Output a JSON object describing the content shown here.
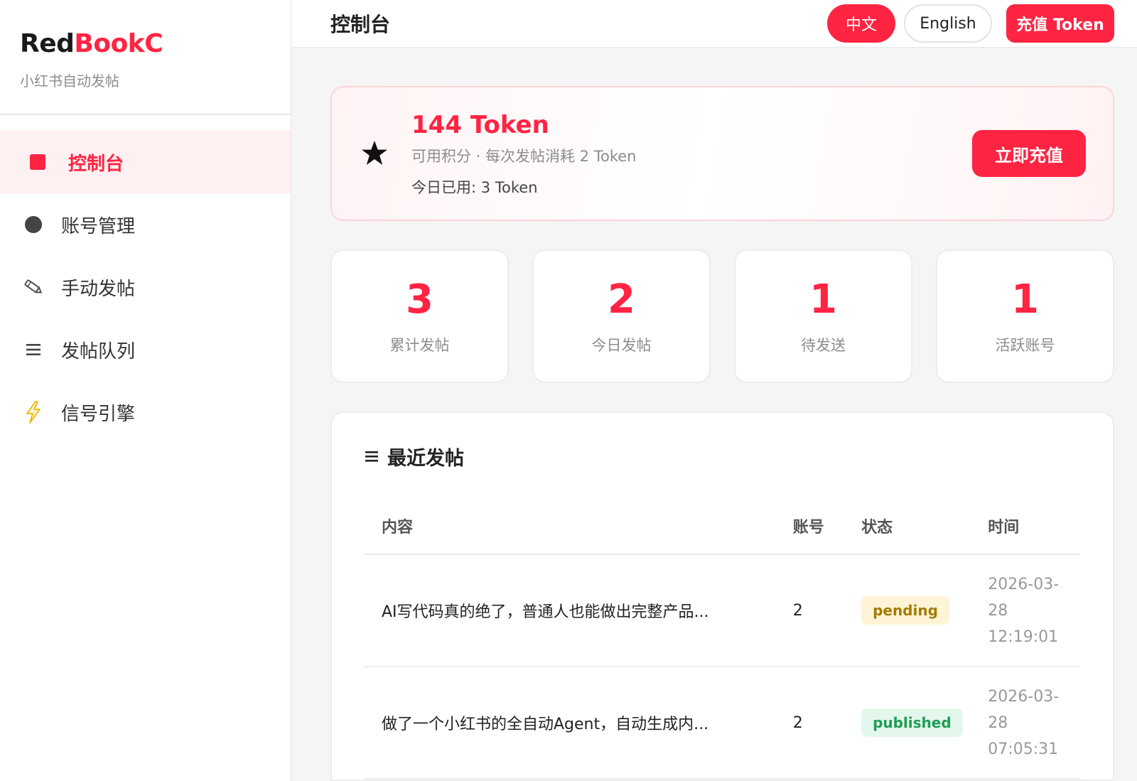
{
  "brand": {
    "name_part1": "Red",
    "name_part2": "BookC",
    "subtitle": "小红书自动发帖"
  },
  "sidebar": {
    "items": [
      {
        "label": "控制台",
        "icon": "dashboard-square-icon",
        "active": true
      },
      {
        "label": "账号管理",
        "icon": "circle-icon"
      },
      {
        "label": "手动发帖",
        "icon": "pencil-icon"
      },
      {
        "label": "发帖队列",
        "icon": "list-icon"
      },
      {
        "label": "信号引擎",
        "icon": "lightning-icon"
      }
    ]
  },
  "header": {
    "title": "控制台",
    "lang_cn": "中文",
    "lang_en": "English",
    "recharge": "充值 Token"
  },
  "token": {
    "amount": "144 Token",
    "description": "可用积分 · 每次发帖消耗 2 Token",
    "used_today": "今日已用: 3 Token",
    "button": "立即充值"
  },
  "stats": [
    {
      "value": "3",
      "label": "累计发帖"
    },
    {
      "value": "2",
      "label": "今日发帖"
    },
    {
      "value": "1",
      "label": "待发送"
    },
    {
      "value": "1",
      "label": "活跃账号"
    }
  ],
  "recent": {
    "title": "最近发帖",
    "columns": [
      "内容",
      "账号",
      "状态",
      "时间"
    ],
    "rows": [
      {
        "content": "AI写代码真的绝了，普通人也能做出完整产品...",
        "account": "2",
        "status": "pending",
        "time_l1": "2026-03-",
        "time_l2": "28",
        "time_l3": "12:19:01"
      },
      {
        "content": "做了一个小红书的全自动Agent，自动生成内...",
        "account": "2",
        "status": "published",
        "time_l1": "2026-03-",
        "time_l2": "28",
        "time_l3": "07:05:31"
      }
    ]
  },
  "colors": {
    "accent": "#ff2442",
    "pending_bg": "#fff4d6",
    "published_bg": "#e4f7ec"
  }
}
